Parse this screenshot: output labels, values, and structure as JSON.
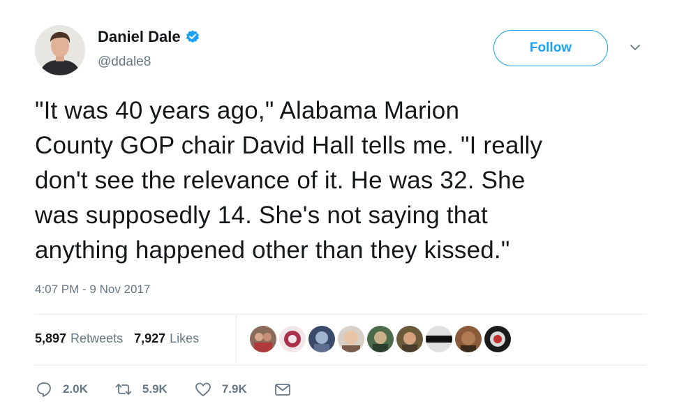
{
  "author": {
    "name": "Daniel Dale",
    "handle": "@ddale8",
    "verified": true
  },
  "follow_label": "Follow",
  "tweet": {
    "text": "\"It was 40 years ago,\" Alabama Marion\nCounty GOP chair David Hall tells me. \"I really\ndon't see the relevance of it. He was 32. She\nwas supposedly 14. She's not saying that\nanything happened other than they kissed.\"",
    "timestamp": "4:07 PM - 9 Nov 2017"
  },
  "stats": {
    "retweets_count": "5,897",
    "retweets_label": "Retweets",
    "likes_count": "7,927",
    "likes_label": "Likes"
  },
  "actions": {
    "reply_count": "2.0K",
    "retweet_count": "5.9K",
    "like_count": "7.9K"
  },
  "colors": {
    "accent": "#1da1f2",
    "muted": "#657786",
    "text": "#14171a",
    "divider": "#e6ecf0"
  }
}
